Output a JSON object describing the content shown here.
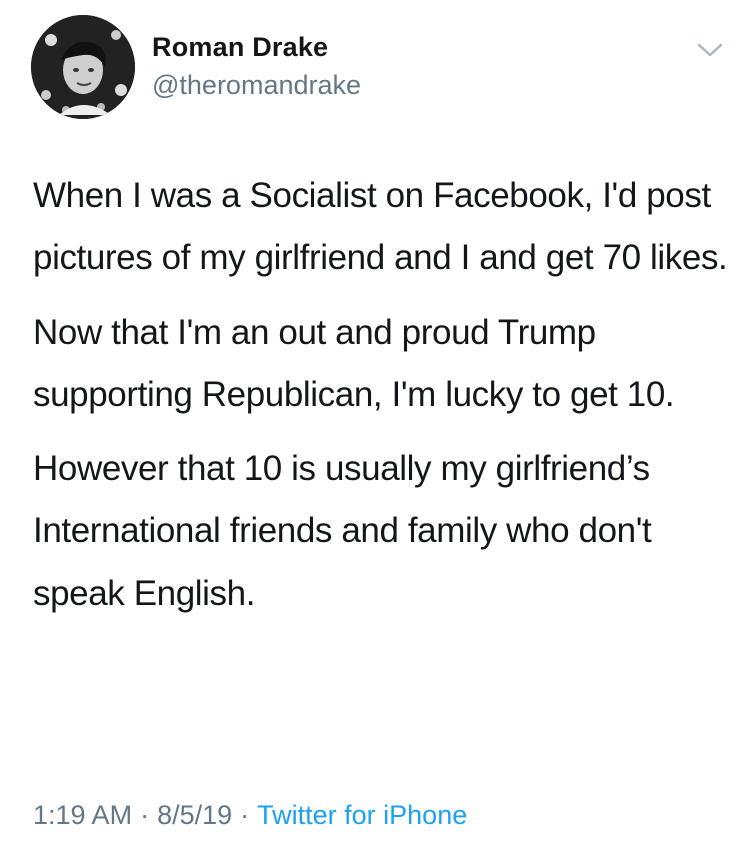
{
  "tweet": {
    "display_name": "Roman Drake",
    "handle": "@theromandrake",
    "paragraphs": [
      "When I was a Socialist on Facebook, I'd post pictures of my girlfriend and I and get 70 likes.",
      "Now that I'm an out and proud Trump supporting Republican, I'm lucky to get 10.",
      "However that 10 is usually my girlfriend’s International friends and family who don't speak English."
    ],
    "time": "1:19 AM",
    "separator": "·",
    "date": "8/5/19",
    "source": "Twitter for iPhone"
  },
  "icons": {
    "menu": "chevron-down-icon",
    "avatar": "profile-photo"
  },
  "colors": {
    "text": "#14171a",
    "muted": "#657786",
    "link": "#1da1f2",
    "chevron": "#aab8c2"
  }
}
